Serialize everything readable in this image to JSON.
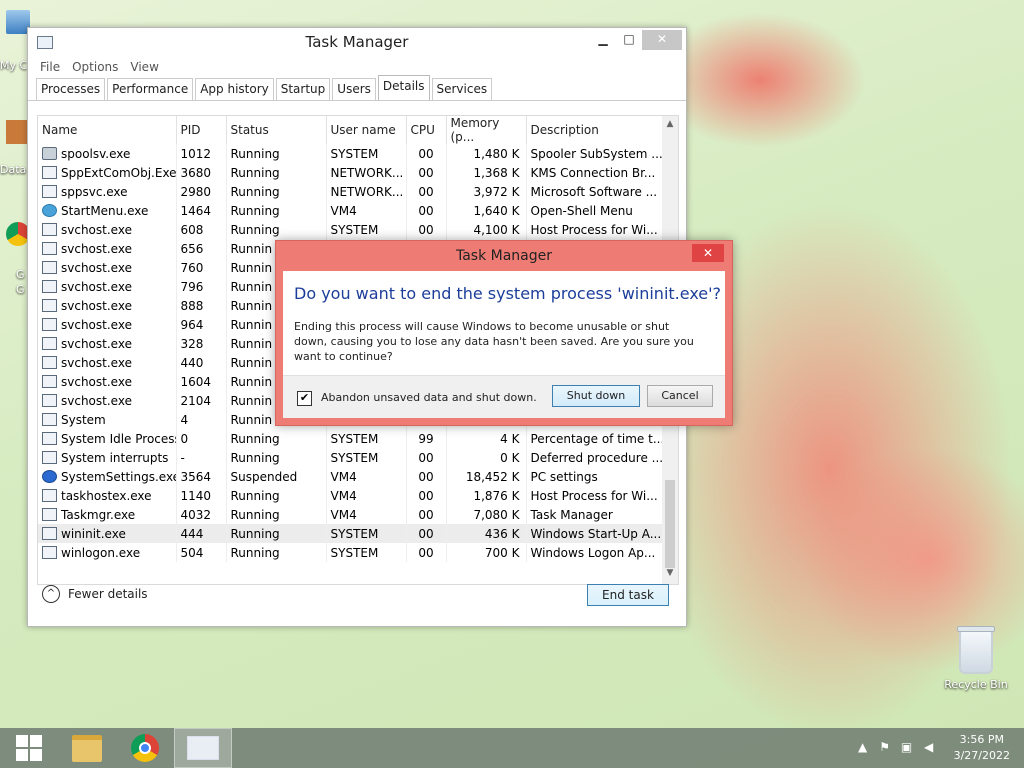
{
  "desktop": {
    "recycle_bin": "Recycle Bin",
    "edge_labels": [
      "My C",
      "Data",
      "G",
      "G"
    ]
  },
  "task_manager": {
    "title": "Task Manager",
    "menu": [
      "File",
      "Options",
      "View"
    ],
    "tabs": [
      "Processes",
      "Performance",
      "App history",
      "Startup",
      "Users",
      "Details",
      "Services"
    ],
    "active_tab": "Details",
    "columns": [
      "Name",
      "PID",
      "Status",
      "User name",
      "CPU",
      "Memory (p...",
      "Description"
    ],
    "rows": [
      {
        "name": "spoolsv.exe",
        "pid": "1012",
        "status": "Running",
        "user": "SYSTEM",
        "cpu": "00",
        "mem": "1,480 K",
        "desc": "Spooler SubSystem ...",
        "icon": "printer-icon"
      },
      {
        "name": "SppExtComObj.Exe",
        "pid": "3680",
        "status": "Running",
        "user": "NETWORK...",
        "cpu": "00",
        "mem": "1,368 K",
        "desc": "KMS Connection Br...",
        "icon": "process-icon"
      },
      {
        "name": "sppsvc.exe",
        "pid": "2980",
        "status": "Running",
        "user": "NETWORK...",
        "cpu": "00",
        "mem": "3,972 K",
        "desc": "Microsoft Software ...",
        "icon": "process-icon"
      },
      {
        "name": "StartMenu.exe",
        "pid": "1464",
        "status": "Running",
        "user": "VM4",
        "cpu": "00",
        "mem": "1,640 K",
        "desc": "Open-Shell Menu",
        "icon": "shell-icon"
      },
      {
        "name": "svchost.exe",
        "pid": "608",
        "status": "Running",
        "user": "SYSTEM",
        "cpu": "00",
        "mem": "4,100 K",
        "desc": "Host Process for Wi...",
        "icon": "process-icon"
      },
      {
        "name": "svchost.exe",
        "pid": "656",
        "status": "Runnin",
        "user": "",
        "cpu": "",
        "mem": "",
        "desc": "",
        "icon": "process-icon"
      },
      {
        "name": "svchost.exe",
        "pid": "760",
        "status": "Runnin",
        "user": "",
        "cpu": "",
        "mem": "",
        "desc": "",
        "icon": "process-icon"
      },
      {
        "name": "svchost.exe",
        "pid": "796",
        "status": "Runnin",
        "user": "",
        "cpu": "",
        "mem": "",
        "desc": "",
        "icon": "process-icon"
      },
      {
        "name": "svchost.exe",
        "pid": "888",
        "status": "Runnin",
        "user": "",
        "cpu": "",
        "mem": "",
        "desc": "",
        "icon": "process-icon"
      },
      {
        "name": "svchost.exe",
        "pid": "964",
        "status": "Runnin",
        "user": "",
        "cpu": "",
        "mem": "",
        "desc": "",
        "icon": "process-icon"
      },
      {
        "name": "svchost.exe",
        "pid": "328",
        "status": "Runnin",
        "user": "",
        "cpu": "",
        "mem": "",
        "desc": "",
        "icon": "process-icon"
      },
      {
        "name": "svchost.exe",
        "pid": "440",
        "status": "Runnin",
        "user": "",
        "cpu": "",
        "mem": "",
        "desc": "",
        "icon": "process-icon"
      },
      {
        "name": "svchost.exe",
        "pid": "1604",
        "status": "Runnin",
        "user": "",
        "cpu": "",
        "mem": "",
        "desc": "",
        "icon": "process-icon"
      },
      {
        "name": "svchost.exe",
        "pid": "2104",
        "status": "Runnin",
        "user": "",
        "cpu": "",
        "mem": "",
        "desc": "",
        "icon": "process-icon"
      },
      {
        "name": "System",
        "pid": "4",
        "status": "Runnin",
        "user": "",
        "cpu": "",
        "mem": "",
        "desc": "",
        "icon": "process-icon"
      },
      {
        "name": "System Idle Process",
        "pid": "0",
        "status": "Running",
        "user": "SYSTEM",
        "cpu": "99",
        "mem": "4 K",
        "desc": "Percentage of time t...",
        "icon": "process-icon"
      },
      {
        "name": "System interrupts",
        "pid": "-",
        "status": "Running",
        "user": "SYSTEM",
        "cpu": "00",
        "mem": "0 K",
        "desc": "Deferred procedure ...",
        "icon": "process-icon"
      },
      {
        "name": "SystemSettings.exe",
        "pid": "3564",
        "status": "Suspended",
        "user": "VM4",
        "cpu": "00",
        "mem": "18,452 K",
        "desc": "PC settings",
        "icon": "gear-icon"
      },
      {
        "name": "taskhostex.exe",
        "pid": "1140",
        "status": "Running",
        "user": "VM4",
        "cpu": "00",
        "mem": "1,876 K",
        "desc": "Host Process for Wi...",
        "icon": "process-icon"
      },
      {
        "name": "Taskmgr.exe",
        "pid": "4032",
        "status": "Running",
        "user": "VM4",
        "cpu": "00",
        "mem": "7,080 K",
        "desc": "Task Manager",
        "icon": "taskmgr-icon"
      },
      {
        "name": "wininit.exe",
        "pid": "444",
        "status": "Running",
        "user": "SYSTEM",
        "cpu": "00",
        "mem": "436 K",
        "desc": "Windows Start-Up A...",
        "icon": "process-icon",
        "selected": true
      },
      {
        "name": "winlogon.exe",
        "pid": "504",
        "status": "Running",
        "user": "SYSTEM",
        "cpu": "00",
        "mem": "700 K",
        "desc": "Windows Logon Ap...",
        "icon": "process-icon"
      }
    ],
    "fewer_details": "Fewer details",
    "end_task": "End task"
  },
  "dialog": {
    "title": "Task Manager",
    "question": "Do you want to end the system process 'wininit.exe'?",
    "message": "Ending this process will cause Windows to become unusable or shut down, causing you to lose any data hasn't been saved. Are you sure you want to continue?",
    "checkbox_label": "Abandon unsaved data and shut down.",
    "checkbox_checked": true,
    "checkbox_mark": "✔",
    "primary_button": "Shut down",
    "secondary_button": "Cancel"
  },
  "taskbar": {
    "time": "3:56 PM",
    "date": "3/27/2022"
  }
}
